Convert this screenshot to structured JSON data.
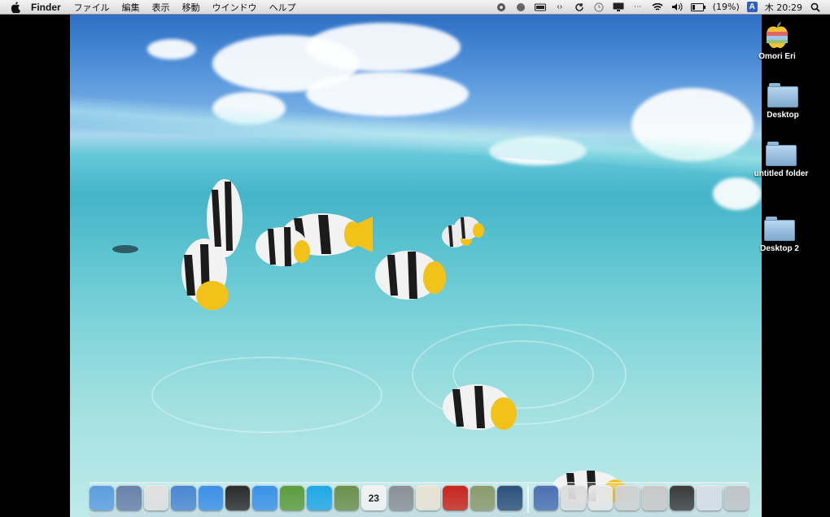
{
  "menubar": {
    "app_name": "Finder",
    "menus": [
      "ファイル",
      "編集",
      "表示",
      "移動",
      "ウインドウ",
      "ヘルプ"
    ],
    "battery_text": "(19%)",
    "input_method": "A",
    "clock": "木 20:29"
  },
  "desktop_icons": [
    {
      "label": "Omori Eri",
      "icon": "user-apple-icon"
    },
    {
      "label": "Desktop",
      "icon": "folder-icon"
    },
    {
      "label": "untitled folder",
      "icon": "folder-icon"
    },
    {
      "label": "Desktop 2",
      "icon": "folder-icon"
    }
  ],
  "dock": {
    "apps": [
      {
        "name": "finder-icon",
        "color": "#5b9de0",
        "running": true
      },
      {
        "name": "preview-icon",
        "color": "#6a7fa8",
        "running": true
      },
      {
        "name": "chrome-icon",
        "color": "#e0e0e0",
        "running": true
      },
      {
        "name": "xcode-icon",
        "color": "#4a86d0",
        "running": false
      },
      {
        "name": "app-store-icon",
        "color": "#3b8ee8",
        "running": false
      },
      {
        "name": "dashboard-icon",
        "color": "#2a2a2a",
        "running": false
      },
      {
        "name": "itunes-icon",
        "color": "#3a90e6",
        "running": false
      },
      {
        "name": "evernote-icon",
        "color": "#5b9b3c",
        "running": true
      },
      {
        "name": "skype-icon",
        "color": "#1fa7e6",
        "running": true
      },
      {
        "name": "iphoto-icon",
        "color": "#6b8f4a",
        "running": false
      },
      {
        "name": "calendar-icon",
        "color": "#f2f2f2",
        "running": false
      },
      {
        "name": "system-preferences-icon",
        "color": "#8a8f96",
        "running": false
      },
      {
        "name": "textedit-icon",
        "color": "#e8e2d2",
        "running": false
      },
      {
        "name": "acrobat-icon",
        "color": "#c8241c",
        "running": true
      },
      {
        "name": "utility-icon",
        "color": "#8a9a6a",
        "running": false
      },
      {
        "name": "screen-icon",
        "color": "#2b4f7a",
        "running": true
      }
    ],
    "docs": [
      {
        "name": "documents-stack-icon",
        "color": "#4a6fb0"
      },
      {
        "name": "window-thumb-icon",
        "color": "#dcdcdc"
      },
      {
        "name": "window-thumb-icon",
        "color": "#e6e6e6"
      },
      {
        "name": "window-thumb-icon",
        "color": "#d0d0d0"
      },
      {
        "name": "window-thumb-icon",
        "color": "#c8c8c8"
      },
      {
        "name": "window-thumb-icon",
        "color": "#3a3a3a"
      },
      {
        "name": "window-thumb-icon",
        "color": "#d6dde6"
      },
      {
        "name": "trash-icon",
        "color": "#bfc4c8"
      }
    ],
    "calendar_day": "23"
  }
}
